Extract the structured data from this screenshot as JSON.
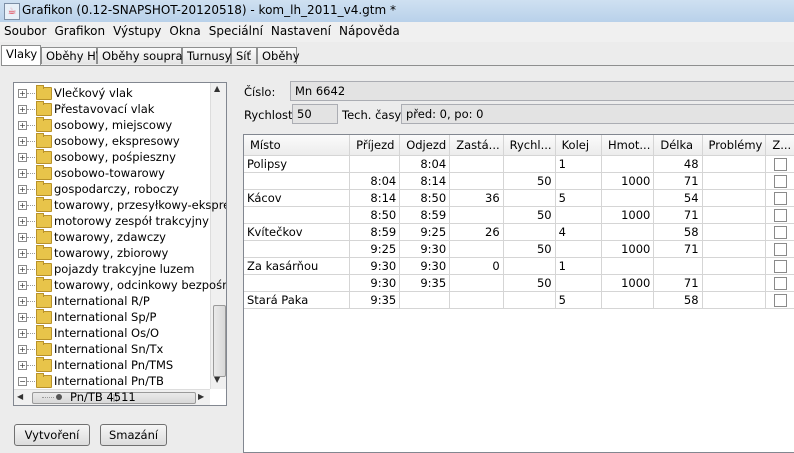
{
  "window": {
    "title": "Grafikon (0.12-SNAPSHOT-20120518) - kom_lh_2011_v4.gtm *"
  },
  "menu": [
    "Soubor",
    "Grafikon",
    "Výstupy",
    "Okna",
    "Speciální",
    "Nastavení",
    "Nápověda"
  ],
  "tabs": [
    "Vlaky",
    "Oběhy HV",
    "Oběhy souprav",
    "Turnusy",
    "Síť",
    "Oběhy"
  ],
  "active_tab": "Vlaky",
  "tree": {
    "groups": [
      "Vlečkový vlak",
      "Přestavovací vlak",
      "osobowy, miejscowy",
      "osobowy, ekspresowy",
      "osobowy, pośpieszny",
      "osobowo-towarowy",
      "gospodarczy, roboczy",
      "towarowy, przesyłkowy-ekspres",
      "motorowy zespół trakcyjny",
      "towarowy, zdawczy",
      "towarowy, zbiorowy",
      "pojazdy trakcyjne luzem",
      "towarowy, odcinkowy bezpośred",
      "International R/P",
      "International Sp/P",
      "International Os/O",
      "International Sn/Tx",
      "International Pn/TMS",
      "International Pn/TB"
    ],
    "leaf": "Pn/TB 4511"
  },
  "buttons": {
    "create": "Vytvoření",
    "delete": "Smazání"
  },
  "train": {
    "number_label": "Číslo:",
    "number_value": "Mn 6642",
    "speed_label": "Rychlost:",
    "speed_value": "50",
    "tech_label": "Tech. časy:",
    "tech_value": "před: 0, po: 0"
  },
  "table": {
    "columns": [
      "Místo",
      "Příjezd",
      "Odjezd",
      "Zastá...",
      "Rychl...",
      "Kolej",
      "Hmot...",
      "Délka",
      "Problémy",
      "Z..."
    ],
    "rows": [
      [
        "Polipsy",
        "",
        "8:04",
        "",
        "",
        "1",
        "",
        "48",
        "",
        ""
      ],
      [
        "",
        "8:04",
        "8:14",
        "",
        "50",
        "",
        "1000",
        "71",
        "",
        ""
      ],
      [
        "Kácov",
        "8:14",
        "8:50",
        "36",
        "",
        "5",
        "",
        "54",
        "",
        ""
      ],
      [
        "",
        "8:50",
        "8:59",
        "",
        "50",
        "",
        "1000",
        "71",
        "",
        ""
      ],
      [
        "Kvítečkov",
        "8:59",
        "9:25",
        "26",
        "",
        "4",
        "",
        "58",
        "",
        ""
      ],
      [
        "",
        "9:25",
        "9:30",
        "",
        "50",
        "",
        "1000",
        "71",
        "",
        ""
      ],
      [
        "Za kasárňou",
        "9:30",
        "9:30",
        "0",
        "",
        "1",
        "",
        "",
        "",
        ""
      ],
      [
        "",
        "9:30",
        "9:35",
        "",
        "50",
        "",
        "1000",
        "71",
        "",
        ""
      ],
      [
        "Stará Paka",
        "9:35",
        "",
        "",
        "",
        "5",
        "",
        "58",
        "",
        ""
      ]
    ]
  }
}
